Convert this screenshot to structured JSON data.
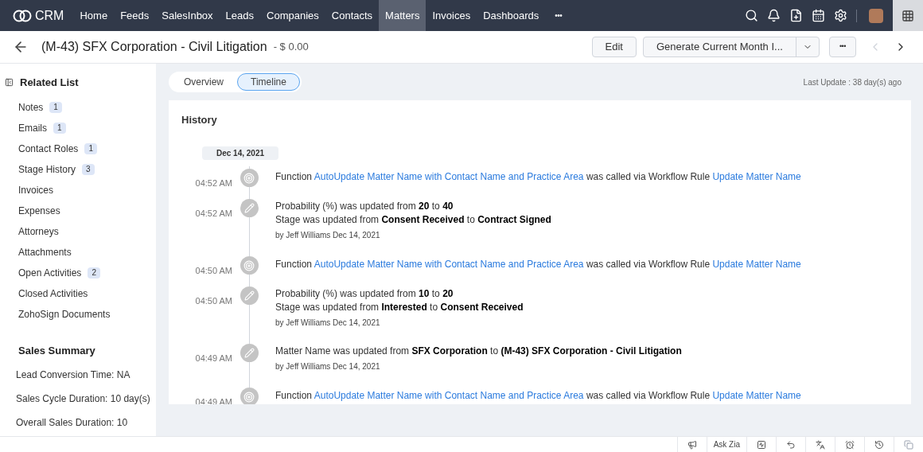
{
  "topbar": {
    "brand": "CRM",
    "tabs": [
      {
        "label": "Home",
        "selected": false
      },
      {
        "label": "Feeds",
        "selected": false
      },
      {
        "label": "SalesInbox",
        "selected": false
      },
      {
        "label": "Leads",
        "selected": false
      },
      {
        "label": "Companies",
        "selected": false
      },
      {
        "label": "Contacts",
        "selected": false
      },
      {
        "label": "Matters",
        "selected": true
      },
      {
        "label": "Invoices",
        "selected": false
      },
      {
        "label": "Dashboards",
        "selected": false
      }
    ],
    "more": "•••"
  },
  "header": {
    "title": "(M-43) SFX Corporation - Civil Litigation",
    "amount": "- $ 0.00",
    "edit": "Edit",
    "action": "Generate Current Month I...",
    "more": "•••"
  },
  "sidebar": {
    "title": "Related List",
    "items": [
      {
        "label": "Notes",
        "count": "1"
      },
      {
        "label": "Emails",
        "count": "1"
      },
      {
        "label": "Contact Roles",
        "count": "1"
      },
      {
        "label": "Stage History",
        "count": "3"
      },
      {
        "label": "Invoices"
      },
      {
        "label": "Expenses"
      },
      {
        "label": "Attorneys"
      },
      {
        "label": "Attachments"
      },
      {
        "label": "Open Activities",
        "count": "2"
      },
      {
        "label": "Closed Activities"
      },
      {
        "label": "ZohoSign Documents"
      }
    ],
    "summary_title": "Sales Summary",
    "summary": [
      "Lead Conversion Time: NA",
      "Sales Cycle Duration: 10 day(s)",
      "Overall Sales Duration: 10"
    ]
  },
  "view_tabs": [
    {
      "label": "Overview",
      "selected": false
    },
    {
      "label": "Timeline",
      "selected": true
    }
  ],
  "last_update": "Last Update : 38 day(s) ago",
  "history": {
    "title": "History",
    "date": "Dec 14, 2021",
    "entries": [
      {
        "kind": "function",
        "time": "04:52 AM",
        "prefix": "Function",
        "function": "AutoUpdate Matter Name with Contact Name and Practice Area",
        "middle": "was called via Workflow Rule",
        "rule": "Update Matter Name"
      },
      {
        "kind": "update",
        "time": "04:52 AM",
        "lines": [
          "Probability (%) was updated from **20** to **40**",
          "Stage was updated from **Consent Received** to **Contract Signed**"
        ],
        "by": "by Jeff Williams Dec 14, 2021"
      },
      {
        "kind": "function",
        "time": "04:50 AM",
        "prefix": "Function",
        "function": "AutoUpdate Matter Name with Contact Name and Practice Area",
        "middle": "was called via Workflow Rule",
        "rule": "Update Matter Name"
      },
      {
        "kind": "update",
        "time": "04:50 AM",
        "lines": [
          "Probability (%) was updated from **10** to **20**",
          "Stage was updated from **Interested** to **Consent Received**"
        ],
        "by": "by Jeff Williams Dec 14, 2021"
      },
      {
        "kind": "update",
        "time": "04:49 AM",
        "lines": [
          "Matter Name was updated from **SFX Corporation** to **(M-43) SFX Corporation - Civil Litigation**"
        ],
        "by": "by Jeff Williams Dec 14, 2021"
      },
      {
        "kind": "function",
        "time": "04:49 AM",
        "prefix": "Function",
        "function": "AutoUpdate Matter Name with Contact Name and Practice Area",
        "middle": "was called via Workflow Rule",
        "rule": "Update Matter Name"
      }
    ]
  },
  "footer": {
    "ask": "Ask Zia"
  }
}
